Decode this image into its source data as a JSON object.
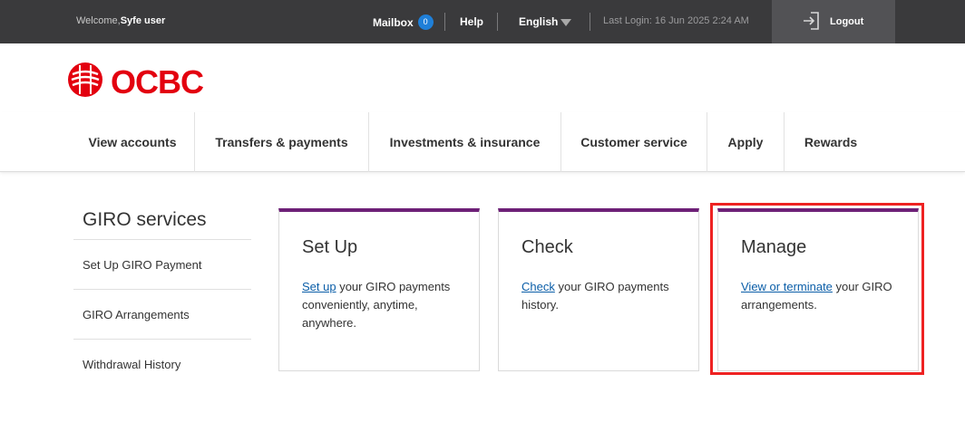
{
  "topbar": {
    "welcome_prefix": "Welcome,",
    "user_name": "Syfe user",
    "mailbox_label": "Mailbox",
    "mailbox_count": "0",
    "help_label": "Help",
    "language": "English",
    "last_login": "Last Login: 16 Jun 2025 2:24 AM",
    "logout_label": "Logout"
  },
  "brand": {
    "logo_text": "OCBC",
    "color": "#e3000f"
  },
  "nav": {
    "items": [
      {
        "label": "View accounts"
      },
      {
        "label": "Transfers & payments"
      },
      {
        "label": "Investments & insurance"
      },
      {
        "label": "Customer service"
      },
      {
        "label": "Apply"
      },
      {
        "label": "Rewards"
      }
    ]
  },
  "sidebar": {
    "title": "GIRO services",
    "items": [
      {
        "label": "Set Up GIRO Payment"
      },
      {
        "label": "GIRO Arrangements"
      },
      {
        "label": "Withdrawal History"
      }
    ]
  },
  "cards": [
    {
      "title": "Set Up",
      "link": "Set up",
      "text": " your GIRO payments conveniently, anytime, anywhere."
    },
    {
      "title": "Check",
      "link": "Check",
      "text": " your GIRO payments history."
    },
    {
      "title": "Manage",
      "link": "View or terminate",
      "text": " your GIRO arrangements."
    }
  ],
  "colors": {
    "topbar_bg": "#3a3a3c",
    "card_accent": "#6d2077",
    "link": "#0b5ea8",
    "highlight": "#ee2222"
  }
}
